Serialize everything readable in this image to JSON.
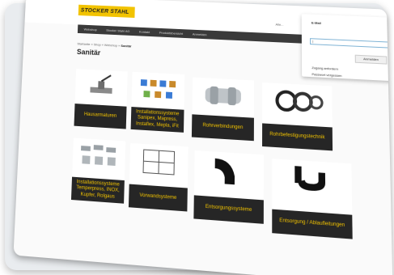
{
  "header": {
    "logo_text": "STOCKER STAHL",
    "search_hint": "Alle...",
    "menu": [
      "Webshop",
      "Stocker Stahl AG",
      "Kontakt",
      "Produktübersicht",
      "Anmelden"
    ]
  },
  "breadcrumb": {
    "trail": "Startseite  »  Shop  »  Webshop  »",
    "current": "Sanitär"
  },
  "page_title": "Sanitär",
  "login_panel": {
    "title": "E-Mail",
    "input_value": "|",
    "button_label": "Anmelden",
    "link_1": "Zugang anfordern",
    "link_2": "Passwort vergessen"
  },
  "categories": [
    {
      "label": "Hausarmaturen",
      "icon": "valve-icon"
    },
    {
      "label": "Installationssysteme Sanipex, Mapress, Instaflex, Mepla, iFit",
      "icon": "fittings-icon"
    },
    {
      "label": "Rohrverbindungen",
      "icon": "coupling-icon"
    },
    {
      "label": "Rohrbefestigungstechnik",
      "icon": "pipe-clamp-icon"
    },
    {
      "label": "Installationssysteme Temperpress, INOX, Kupfer, Rolgaus",
      "icon": "press-fittings-icon"
    },
    {
      "label": "Vorwandsysteme",
      "icon": "frame-icon"
    },
    {
      "label": "Entsorgungssysteme",
      "icon": "drain-bend-icon"
    },
    {
      "label": "Entsorgung / Ablaufleitungen",
      "icon": "siphon-icon"
    }
  ],
  "colors": {
    "accent": "#f2c300",
    "dark": "#262626"
  }
}
